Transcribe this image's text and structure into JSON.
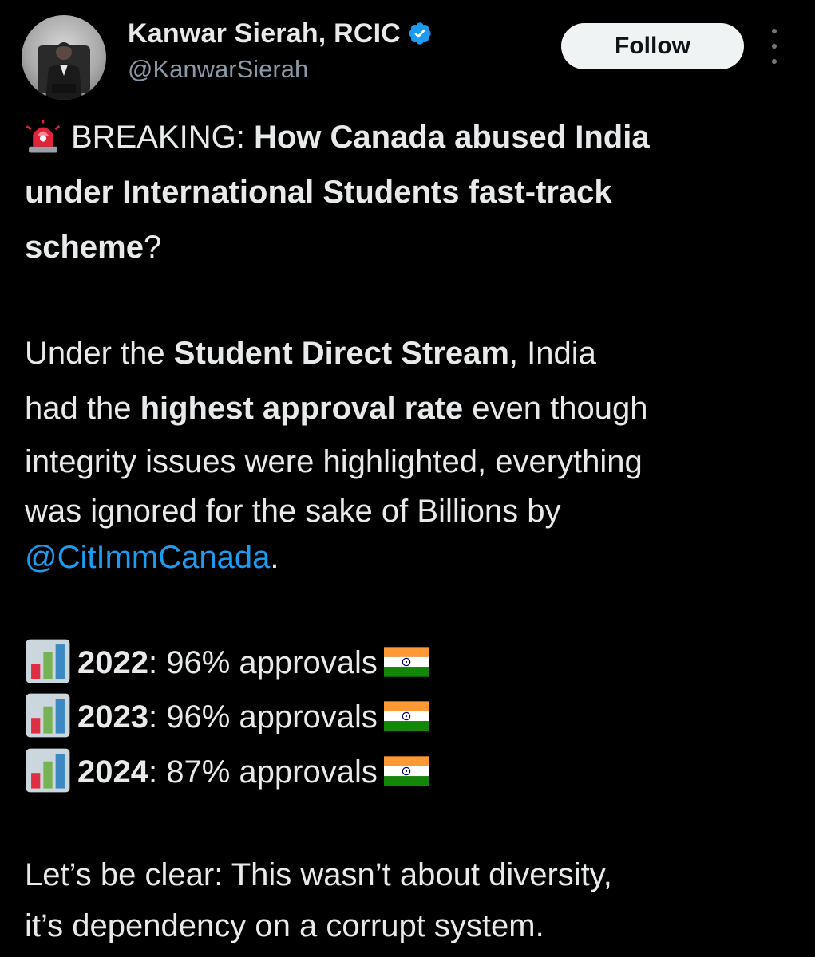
{
  "author": {
    "display_name": "Kanwar Sierah, RCIC",
    "handle": "@KanwarSierah",
    "verified": true,
    "avatar_icon": "profile-photo"
  },
  "actions": {
    "follow_label": "Follow",
    "more_icon": "more-vertical-icon"
  },
  "tweet": {
    "headline": {
      "emoji": "police-light",
      "prefix": "BREAKING: ",
      "line1_bold": "How Canada abused India",
      "line2_bold": "under International Students fast-track",
      "line3_bold": "scheme",
      "line3_end": "?"
    },
    "para1": {
      "l1_a": "Under the ",
      "l1_bold": "Student Direct Stream",
      "l1_b": ", India",
      "l2_a": "had the ",
      "l2_bold": "highest approval rate",
      "l2_b": " even though",
      "l3": "integrity issues were highlighted, everything",
      "l4": "was ignored for the sake of Billions by",
      "mention": "@CitImmCanada",
      "l5_end": "."
    },
    "stats": [
      {
        "year": "2022",
        "sep": ":",
        "text": " 96% approvals"
      },
      {
        "year": "2023",
        "sep": ":",
        "text": " 96% approvals"
      },
      {
        "year": "2024",
        "sep": ":",
        "text": " 87% approvals"
      }
    ],
    "closing": {
      "l1": "Let’s be clear: This wasn’t about diversity,",
      "l2": "it’s dependency on a corrupt system."
    }
  },
  "colors": {
    "background": "#000000",
    "text": "#e7e9ea",
    "secondary": "#8b98a5",
    "link": "#1d9bf0",
    "verified": "#1d9bf0",
    "button_bg": "#eff3f4"
  }
}
